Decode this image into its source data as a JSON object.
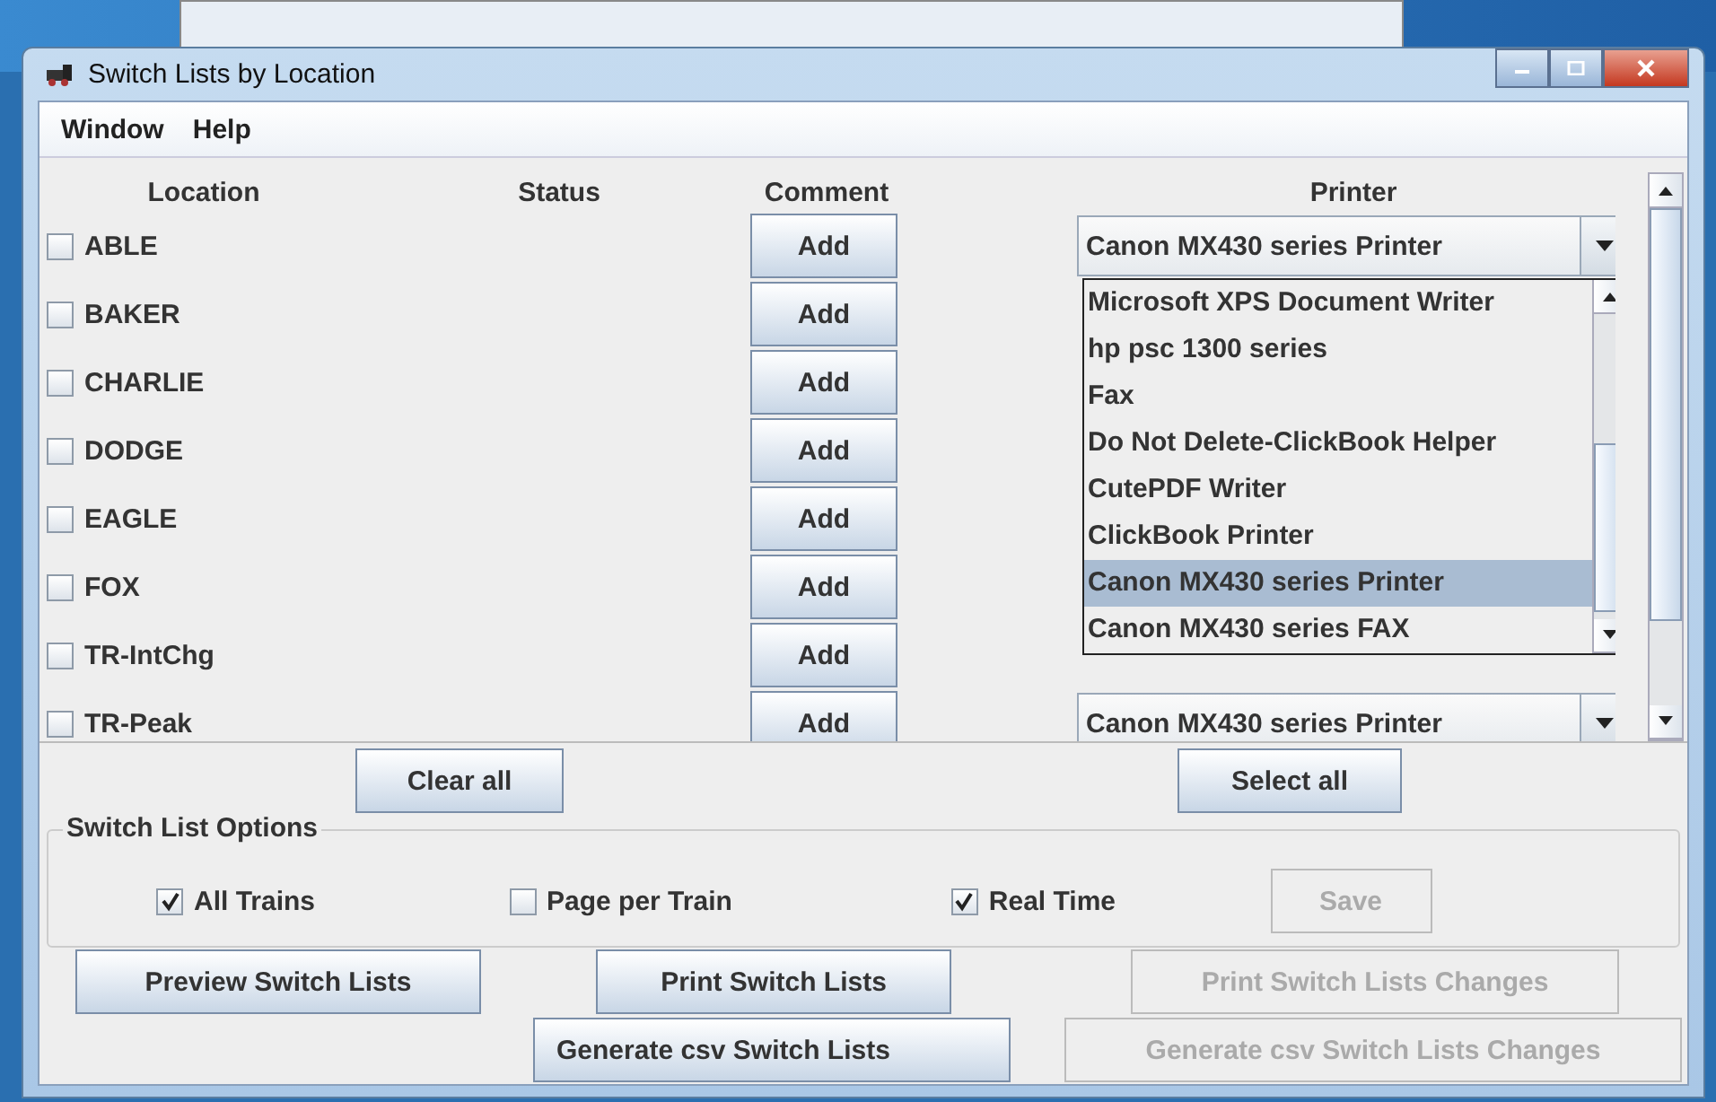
{
  "window": {
    "title": "Switch Lists by Location"
  },
  "menu": [
    "Window",
    "Help"
  ],
  "table": {
    "columns": [
      "Location",
      "Status",
      "Comment",
      "Printer"
    ],
    "rows": [
      {
        "location": "ABLE",
        "checked": false,
        "comment": "Add",
        "printer": "Canon MX430 series Printer"
      },
      {
        "location": "BAKER",
        "checked": false,
        "comment": "Add"
      },
      {
        "location": "CHARLIE",
        "checked": false,
        "comment": "Add"
      },
      {
        "location": "DODGE",
        "checked": false,
        "comment": "Add"
      },
      {
        "location": "EAGLE",
        "checked": false,
        "comment": "Add"
      },
      {
        "location": "FOX",
        "checked": false,
        "comment": "Add"
      },
      {
        "location": "TR-IntChg",
        "checked": false,
        "comment": "Add"
      },
      {
        "location": "TR-Peak",
        "checked": false,
        "comment": "Add",
        "printer": "Canon MX430 series Printer"
      }
    ]
  },
  "printer_dropdown": {
    "items": [
      {
        "label": "Microsoft XPS Document Writer",
        "selected": false
      },
      {
        "label": "hp psc 1300 series",
        "selected": false
      },
      {
        "label": "Fax",
        "selected": false
      },
      {
        "label": "Do Not Delete-ClickBook Helper",
        "selected": false
      },
      {
        "label": "CutePDF Writer",
        "selected": false
      },
      {
        "label": "ClickBook Printer",
        "selected": false
      },
      {
        "label": "Canon MX430 series Printer",
        "selected": true
      },
      {
        "label": "Canon MX430 series FAX",
        "selected": false
      }
    ]
  },
  "table_buttons": [
    "Clear all",
    "Select all"
  ],
  "options": {
    "title": "Switch List Options",
    "checkboxes": [
      {
        "label": "All Trains",
        "checked": true
      },
      {
        "label": "Page per Train",
        "checked": false
      },
      {
        "label": "Real Time",
        "checked": true
      }
    ],
    "save_button": {
      "label": "Save",
      "disabled": true
    }
  },
  "buttons": [
    {
      "label": "Preview Switch Lists",
      "disabled": false
    },
    {
      "label": "Print Switch Lists",
      "disabled": false
    },
    {
      "label": "Print Switch Lists Changes",
      "disabled": true
    },
    {
      "label": "Generate csv Switch Lists",
      "disabled": false
    },
    {
      "label": "Generate csv Switch Lists Changes",
      "disabled": true
    }
  ]
}
